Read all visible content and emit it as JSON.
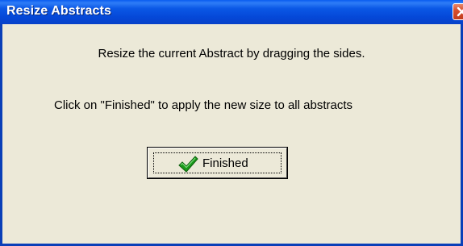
{
  "window": {
    "title": "Resize Abstracts",
    "close_icon": "close-icon"
  },
  "message": {
    "line1": "Resize the current Abstract by dragging the sides.",
    "line2": "Click on \"Finished\" to apply the new size to all abstracts"
  },
  "finished_button": {
    "label": "Finished",
    "icon": "checkmark-icon",
    "icon_color": "#1a9a1a"
  },
  "colors": {
    "titlebar": "#0548d8",
    "dialog_background": "#ece9d8",
    "close_button": "#d8502e"
  }
}
